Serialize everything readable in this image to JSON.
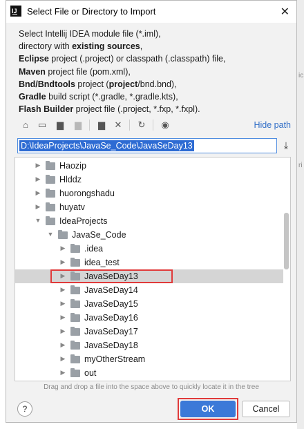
{
  "dialog": {
    "title": "Select File or Directory to Import",
    "description": [
      [
        {
          "t": "Select Intellij IDEA module file (*.iml),",
          "b": false
        }
      ],
      [
        {
          "t": "directory with ",
          "b": false
        },
        {
          "t": "existing sources",
          "b": true
        },
        {
          "t": ",",
          "b": false
        }
      ],
      [
        {
          "t": "Eclipse",
          "b": true
        },
        {
          "t": " project (.project) or classpath (.classpath) file,",
          "b": false
        }
      ],
      [
        {
          "t": "Maven",
          "b": true
        },
        {
          "t": " project file (pom.xml),",
          "b": false
        }
      ],
      [
        {
          "t": "Bnd/Bndtools",
          "b": true
        },
        {
          "t": " project (",
          "b": false
        },
        {
          "t": "project",
          "b": true
        },
        {
          "t": "/bnd.bnd),",
          "b": false
        }
      ],
      [
        {
          "t": "Gradle",
          "b": true
        },
        {
          "t": " build script (*.gradle, *.gradle.kts),",
          "b": false
        }
      ],
      [
        {
          "t": "Flash Builder",
          "b": true
        },
        {
          "t": " project file (.project, *.fxp, *.fxpl).",
          "b": false
        }
      ]
    ],
    "hide_path_label": "Hide path",
    "path_value": "D:\\IdeaProjects\\JavaSe_Code\\JavaSeDay13",
    "hint": "Drag and drop a file into the space above to quickly locate it in the tree",
    "ok_label": "OK",
    "cancel_label": "Cancel",
    "help_label": "?"
  },
  "toolbar_icons": [
    "home-icon",
    "desktop-icon",
    "project-icon",
    "module-icon",
    "new-folder-icon",
    "delete-icon",
    "refresh-icon",
    "show-hidden-icon"
  ],
  "tree": [
    {
      "label": "Haozip",
      "expanded": false
    },
    {
      "label": "Hlddz",
      "expanded": false
    },
    {
      "label": "huorongshadu",
      "expanded": false
    },
    {
      "label": "huyatv",
      "expanded": false
    },
    {
      "label": "IdeaProjects",
      "expanded": true
    },
    {
      "label": "JavaSe_Code",
      "expanded": true
    },
    {
      "label": ".idea",
      "expanded": false
    },
    {
      "label": "idea_test",
      "expanded": false
    },
    {
      "label": "JavaSeDay13",
      "expanded": false,
      "selected": true
    },
    {
      "label": "JavaSeDay14",
      "expanded": false
    },
    {
      "label": "JavaSeDay15",
      "expanded": false
    },
    {
      "label": "JavaSeDay16",
      "expanded": false
    },
    {
      "label": "JavaSeDay17",
      "expanded": false
    },
    {
      "label": "JavaSeDay18",
      "expanded": false
    },
    {
      "label": "myOtherStream",
      "expanded": false
    },
    {
      "label": "out",
      "expanded": false
    }
  ],
  "background_fragments": [
    "ic",
    "ri"
  ]
}
